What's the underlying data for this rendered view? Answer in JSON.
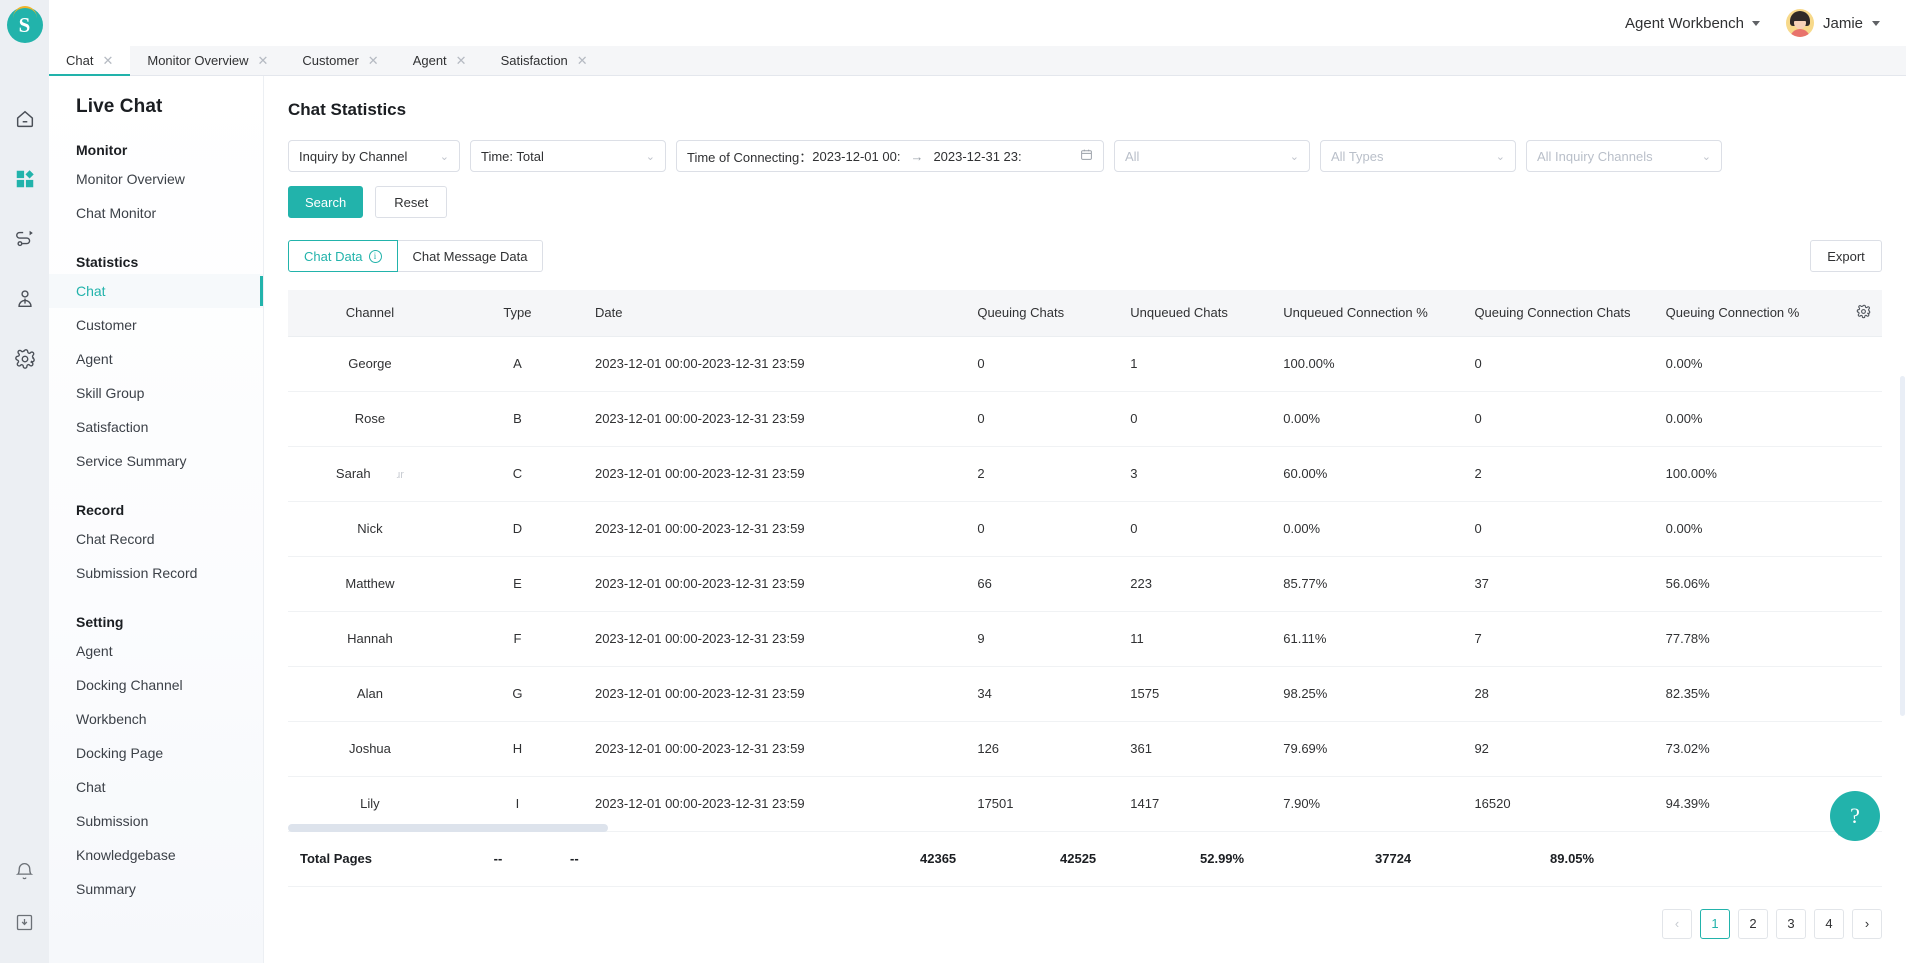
{
  "topbar": {
    "workbench_label": "Agent Workbench",
    "user_name": "Jamie",
    "workbench_icon": "chevron-down-icon",
    "user_icon": "chevron-down-icon"
  },
  "rail": {
    "logo_text": "S",
    "icons": [
      "home-icon",
      "dashboard-icon",
      "flow-icon",
      "customer-icon",
      "gear-icon"
    ],
    "bottom_icons": [
      "bell-icon",
      "download-box-icon"
    ]
  },
  "tabs": [
    {
      "label": "Chat",
      "active": true
    },
    {
      "label": "Monitor Overview",
      "active": false
    },
    {
      "label": "Customer",
      "active": false
    },
    {
      "label": "Agent",
      "active": false
    },
    {
      "label": "Satisfaction",
      "active": false
    }
  ],
  "sidebar": {
    "title": "Live Chat",
    "sections": [
      {
        "group": "Monitor",
        "items": [
          {
            "label": "Monitor Overview",
            "active": false
          },
          {
            "label": "Chat Monitor",
            "active": false
          }
        ]
      },
      {
        "group": "Statistics",
        "items": [
          {
            "label": "Chat",
            "active": true
          },
          {
            "label": "Customer",
            "active": false
          },
          {
            "label": "Agent",
            "active": false
          },
          {
            "label": "Skill Group",
            "active": false
          },
          {
            "label": "Satisfaction",
            "active": false
          },
          {
            "label": "Service Summary",
            "active": false
          }
        ]
      },
      {
        "group": "Record",
        "items": [
          {
            "label": "Chat Record",
            "active": false
          },
          {
            "label": "Submission Record",
            "active": false
          }
        ]
      },
      {
        "group": "Setting",
        "items": [
          {
            "label": "Agent",
            "active": false
          },
          {
            "label": "Docking Channel",
            "active": false
          },
          {
            "label": "Workbench",
            "active": false
          },
          {
            "label": "Docking Page",
            "active": false
          },
          {
            "label": "Chat",
            "active": false
          },
          {
            "label": "Submission",
            "active": false
          },
          {
            "label": "Knowledgebase",
            "active": false
          },
          {
            "label": "Summary",
            "active": false
          }
        ]
      }
    ]
  },
  "page": {
    "title": "Chat Statistics"
  },
  "filters": {
    "dimension": "Inquiry by Channel",
    "time": "Time: Total",
    "date_label": "Time of Connecting：",
    "date_start": "2023-12-01 00:",
    "date_sep": "→",
    "date_end": "2023-12-31 23:",
    "date_icon": "calendar-icon",
    "all": "All",
    "all_types": "All Types",
    "all_channels": "All Inquiry Channels"
  },
  "actions": {
    "search": "Search",
    "reset": "Reset",
    "export": "Export"
  },
  "data_tabs": [
    {
      "label": "Chat Data",
      "active": true,
      "info_icon": "info-icon"
    },
    {
      "label": "Chat Message Data",
      "active": false
    }
  ],
  "table": {
    "gear_icon": "column-settings-gear-icon",
    "columns": [
      "Channel",
      "Type",
      "Date",
      "Queuing Chats",
      "Unqueued Chats",
      "Unqueued Connection %",
      "Queuing Connection Chats",
      "Queuing Connection %"
    ],
    "rows": [
      {
        "channel": "George",
        "type": "A",
        "date": "2023-12-01 00:00-2023-12-31 23:59",
        "queuing_chats": "0",
        "unqueued_chats": "1",
        "unqueued_conn_pct": "100.00%",
        "queuing_conn_chats": "0",
        "queuing_conn_pct": "0.00%"
      },
      {
        "channel": "Rose",
        "type": "B",
        "date": "2023-12-01 00:00-2023-12-31 23:59",
        "queuing_chats": "0",
        "unqueued_chats": "0",
        "unqueued_conn_pct": "0.00%",
        "queuing_conn_chats": "0",
        "queuing_conn_pct": "0.00%"
      },
      {
        "channel": "Sarah",
        "ghost": "ɹr",
        "type": "C",
        "date": "2023-12-01 00:00-2023-12-31 23:59",
        "queuing_chats": "2",
        "unqueued_chats": "3",
        "unqueued_conn_pct": "60.00%",
        "queuing_conn_chats": "2",
        "queuing_conn_pct": "100.00%"
      },
      {
        "channel": "Nick",
        "type": "D",
        "date": "2023-12-01 00:00-2023-12-31 23:59",
        "queuing_chats": "0",
        "unqueued_chats": "0",
        "unqueued_conn_pct": "0.00%",
        "queuing_conn_chats": "0",
        "queuing_conn_pct": "0.00%"
      },
      {
        "channel": "Matthew",
        "type": "E",
        "date": "2023-12-01 00:00-2023-12-31 23:59",
        "queuing_chats": "66",
        "unqueued_chats": "223",
        "unqueued_conn_pct": "85.77%",
        "queuing_conn_chats": "37",
        "queuing_conn_pct": "56.06%"
      },
      {
        "channel": "Hannah",
        "type": "F",
        "date": "2023-12-01 00:00-2023-12-31 23:59",
        "queuing_chats": "9",
        "unqueued_chats": "11",
        "unqueued_conn_pct": "61.11%",
        "queuing_conn_chats": "7",
        "queuing_conn_pct": "77.78%"
      },
      {
        "channel": "Alan",
        "type": "G",
        "date": "2023-12-01 00:00-2023-12-31 23:59",
        "queuing_chats": "34",
        "unqueued_chats": "1575",
        "unqueued_conn_pct": "98.25%",
        "queuing_conn_chats": "28",
        "queuing_conn_pct": "82.35%"
      },
      {
        "channel": "Joshua",
        "type": "H",
        "date": "2023-12-01 00:00-2023-12-31 23:59",
        "queuing_chats": "126",
        "unqueued_chats": "361",
        "unqueued_conn_pct": "79.69%",
        "queuing_conn_chats": "92",
        "queuing_conn_pct": "73.02%"
      },
      {
        "channel": "Lily",
        "type": "I",
        "date": "2023-12-01 00:00-2023-12-31 23:59",
        "queuing_chats": "17501",
        "unqueued_chats": "1417",
        "unqueued_conn_pct": "7.90%",
        "queuing_conn_chats": "16520",
        "queuing_conn_pct": "94.39%"
      }
    ],
    "total": {
      "label": "Total Pages",
      "type": "--",
      "date": "--",
      "queuing_chats": "42365",
      "unqueued_chats": "42525",
      "unqueued_conn_pct": "52.99%",
      "queuing_conn_chats": "37724",
      "queuing_conn_pct": "89.05%"
    }
  },
  "pagination": {
    "prev": "‹",
    "next": "›",
    "pages": [
      "1",
      "2",
      "3",
      "4"
    ],
    "current": "1"
  },
  "help": {
    "icon": "help-question-icon",
    "label": "?"
  },
  "colors": {
    "accent": "#22b3ab",
    "rail_bg": "#eceff3",
    "tab_bg": "#f5f6f8",
    "border": "#dcdfe6"
  }
}
